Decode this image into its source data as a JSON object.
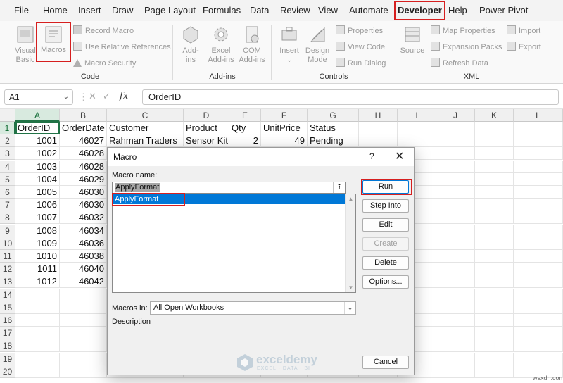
{
  "menu": {
    "items": [
      "File",
      "Home",
      "Insert",
      "Draw",
      "Page Layout",
      "Formulas",
      "Data",
      "Review",
      "View",
      "Automate",
      "Developer",
      "Help",
      "Power Pivot"
    ],
    "active": "Developer"
  },
  "ribbon": {
    "code": {
      "visual_basic": "Visual Basic",
      "macros": "Macros",
      "record_macro": "Record Macro",
      "use_relative_refs": "Use Relative References",
      "macro_security": "Macro Security",
      "label": "Code"
    },
    "addins": {
      "addins": "Add-ins",
      "excel_addins": "Excel Add-ins",
      "com_addins": "COM Add-ins",
      "label": "Add-ins"
    },
    "controls": {
      "insert": "Insert",
      "design_mode": "Design Mode",
      "properties": "Properties",
      "view_code": "View Code",
      "run_dialog": "Run Dialog",
      "label": "Controls"
    },
    "xml": {
      "source": "Source",
      "map_properties": "Map Properties",
      "expansion_packs": "Expansion Packs",
      "refresh_data": "Refresh Data",
      "import": "Import",
      "export": "Export",
      "label": "XML"
    }
  },
  "formula_bar": {
    "name_box": "A1",
    "fx": "fx",
    "content": "OrderID"
  },
  "sheet": {
    "columns": [
      "A",
      "B",
      "C",
      "D",
      "E",
      "F",
      "G",
      "H",
      "I",
      "J",
      "K",
      "L"
    ],
    "rows": [
      "1",
      "2",
      "3",
      "4",
      "5",
      "6",
      "7",
      "8",
      "9",
      "10",
      "11",
      "12",
      "13",
      "14",
      "15",
      "16",
      "17",
      "18",
      "19",
      "20"
    ],
    "headers": [
      "OrderID",
      "OrderDate",
      "Customer",
      "Product",
      "Qty",
      "UnitPrice",
      "Status"
    ],
    "row2": {
      "customer": "Rahman Traders",
      "product": "Sensor Kit",
      "qty": "2",
      "price": "49",
      "status": "Pending"
    },
    "order_ids": [
      "1001",
      "1002",
      "1003",
      "1004",
      "1005",
      "1006",
      "1007",
      "1008",
      "1009",
      "1010",
      "1011",
      "1012"
    ],
    "order_dates": [
      "46027",
      "46028",
      "46028",
      "46029",
      "46030",
      "46030",
      "46032",
      "46034",
      "46036",
      "46038",
      "46040",
      "46042"
    ]
  },
  "dialog": {
    "title": "Macro",
    "help": "?",
    "close": "✕",
    "macro_name_label": "Macro name:",
    "macro_name_value": "ApplyFormat",
    "list_items": [
      "ApplyFormat"
    ],
    "buttons": {
      "run": "Run",
      "step_into": "Step Into",
      "edit": "Edit",
      "create": "Create",
      "delete": "Delete",
      "options": "Options...",
      "cancel": "Cancel"
    },
    "macros_in_label": "Macros in:",
    "macros_in_value": "All Open Workbooks",
    "description_label": "Description"
  },
  "watermark": {
    "name": "exceldemy",
    "tagline": "EXCEL · DATA · BI"
  },
  "site_label": "wsxdn.com",
  "colors": {
    "accent_green": "#217346",
    "highlight_red": "#d61f1f",
    "selection_blue": "#0078d7"
  }
}
